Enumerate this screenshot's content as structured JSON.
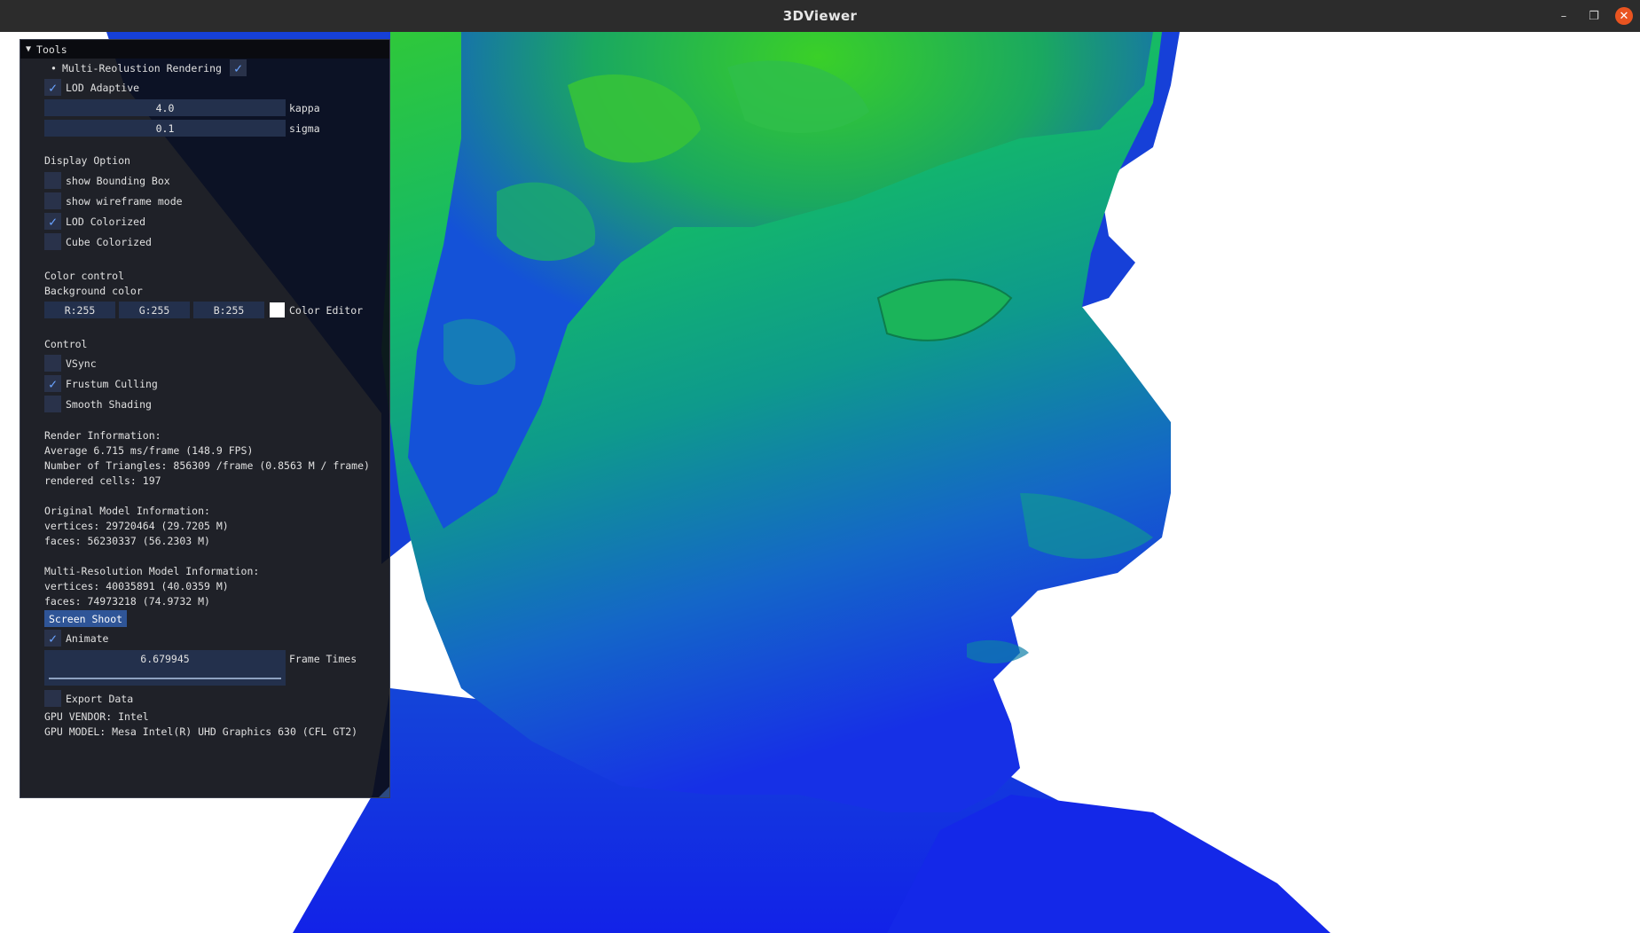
{
  "window": {
    "title": "3DViewer",
    "minimize_label": "–",
    "maximize_label": "❐",
    "close_label": "✕"
  },
  "panel": {
    "title": "Tools",
    "multi_res": {
      "label": "Multi-Reolustion Rendering",
      "checked": true
    },
    "lod_adaptive": {
      "label": "LOD Adaptive",
      "checked": true
    },
    "kappa": {
      "value": "4.0",
      "label": "kappa"
    },
    "sigma": {
      "value": "0.1",
      "label": "sigma"
    },
    "display_option": {
      "heading": "Display Option",
      "items": [
        {
          "label": "show Bounding Box",
          "checked": false
        },
        {
          "label": "show wireframe mode",
          "checked": false
        },
        {
          "label": "LOD Colorized",
          "checked": true
        },
        {
          "label": "Cube Colorized",
          "checked": false
        }
      ]
    },
    "color_control": {
      "heading": "Color control",
      "bg_label": "Background color",
      "r": "R:255",
      "g": "G:255",
      "b": "B:255",
      "editor_label": "Color Editor",
      "swatch_color": "#ffffff"
    },
    "control": {
      "heading": "Control",
      "items": [
        {
          "label": "VSync",
          "checked": false
        },
        {
          "label": "Frustum Culling",
          "checked": true
        },
        {
          "label": "Smooth Shading",
          "checked": false
        }
      ]
    },
    "render_info": {
      "heading": "Render Information:",
      "average": "Average 6.715 ms/frame (148.9 FPS)",
      "triangles": "Number of Triangles: 856309 /frame (0.8563 M / frame)",
      "cells": "rendered cells: 197"
    },
    "original_model": {
      "heading": "Original Model Information:",
      "vertices": "vertices: 29720464 (29.7205 M)",
      "faces": "faces: 56230337 (56.2303 M)"
    },
    "multires_model": {
      "heading": "Multi-Resolution Model Information:",
      "vertices": "vertices: 40035891 (40.0359 M)",
      "faces": "faces: 74973218 (74.9732 M)"
    },
    "screenshot_button": "Screen Shoot",
    "animate": {
      "label": "Animate",
      "checked": true
    },
    "frame_times": {
      "value": "6.679945",
      "label": "Frame Times"
    },
    "export_data": {
      "label": "Export Data",
      "checked": false
    },
    "gpu_vendor": "GPU VENDOR: Intel",
    "gpu_model": "GPU MODEL: Mesa Intel(R) UHD Graphics 630 (CFL GT2)"
  },
  "colors": {
    "lod_green": "#1ec85a",
    "lod_teal": "#0e8f9a",
    "lod_blue": "#1430e0",
    "checkmark": "#6aa3ff",
    "button": "#2f5597"
  },
  "icons": {
    "collapse": "triangle-down-icon",
    "check": "checkmark-icon"
  }
}
